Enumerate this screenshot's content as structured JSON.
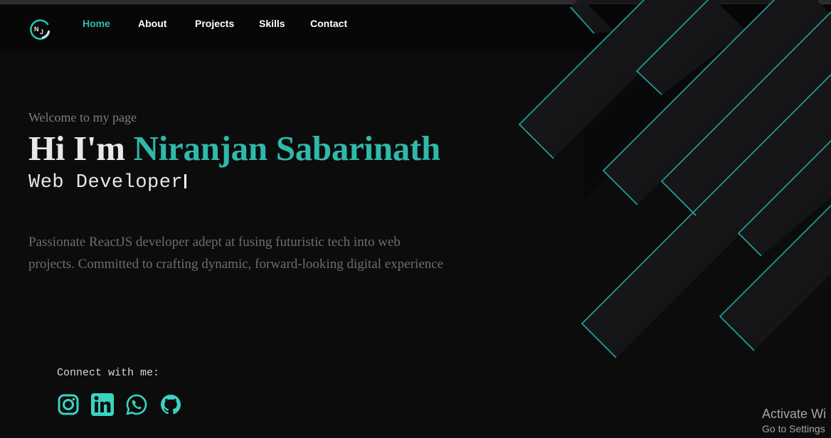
{
  "nav": {
    "logo_icon": "nj-monogram-logo",
    "items": [
      {
        "label": "Home",
        "active": true
      },
      {
        "label": "About",
        "active": false
      },
      {
        "label": "Projects",
        "active": false
      },
      {
        "label": "Skills",
        "active": false
      },
      {
        "label": "Contact",
        "active": false
      }
    ]
  },
  "hero": {
    "welcome": "Welcome to my page",
    "greeting_prefix": "Hi I'm ",
    "name": "Niranjan Sabarinath",
    "role": "Web Developer",
    "bio": "Passionate ReactJS developer adept at fusing futuristic tech into web projects. Committed to crafting dynamic, forward-looking digital experience"
  },
  "connect": {
    "label": "Connect with me:",
    "icons": [
      "instagram-icon",
      "linkedin-icon",
      "whatsapp-icon",
      "github-icon"
    ]
  },
  "watermark": {
    "title": "Activate Wi",
    "subtitle": "Go to Settings"
  },
  "colors": {
    "accent": "#2fb9aa",
    "background": "#0c0c0d",
    "navbar": "#070708",
    "text": "#e9e9e9",
    "muted": "#6d6d70"
  }
}
